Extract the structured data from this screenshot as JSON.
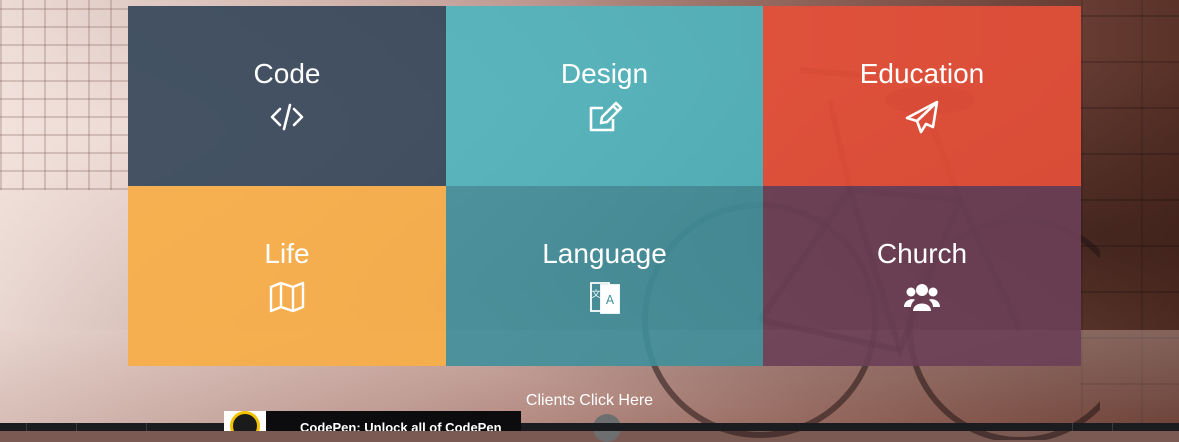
{
  "tiles": [
    {
      "label": "Code",
      "icon": "code-icon",
      "color": "#35465a"
    },
    {
      "label": "Design",
      "icon": "edit-icon",
      "color": "#4fb4bd"
    },
    {
      "label": "Education",
      "icon": "paper-plane-icon",
      "color": "#e54f38"
    },
    {
      "label": "Life",
      "icon": "map-icon",
      "color": "#f7ae4a"
    },
    {
      "label": "Language",
      "icon": "language-icon",
      "color": "#3f8f9b"
    },
    {
      "label": "Church",
      "icon": "users-icon",
      "color": "#6c3f57"
    }
  ],
  "clients_link": "Clients Click Here",
  "promo": {
    "text": "CodePen: Unlock all of CodePen"
  }
}
